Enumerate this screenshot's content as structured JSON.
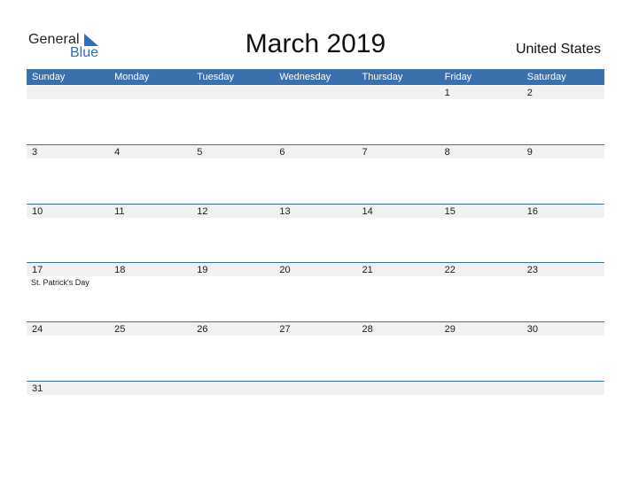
{
  "logo": {
    "general": "General",
    "blue": "Blue"
  },
  "title": "March 2019",
  "country": "United States",
  "weekdays": [
    "Sunday",
    "Monday",
    "Tuesday",
    "Wednesday",
    "Thursday",
    "Friday",
    "Saturday"
  ],
  "weeks": [
    [
      "",
      "",
      "",
      "",
      "",
      "1",
      "2"
    ],
    [
      "3",
      "4",
      "5",
      "6",
      "7",
      "8",
      "9"
    ],
    [
      "10",
      "11",
      "12",
      "13",
      "14",
      "15",
      "16"
    ],
    [
      "17",
      "18",
      "19",
      "20",
      "21",
      "22",
      "23"
    ],
    [
      "24",
      "25",
      "26",
      "27",
      "28",
      "29",
      "30"
    ],
    [
      "31",
      "",
      "",
      "",
      "",
      "",
      ""
    ]
  ],
  "holidays": {
    "st_patricks": "St. Patrick's Day"
  },
  "colors": {
    "accent": "#3a6fb0",
    "logo_blue": "#2a6fc0",
    "day_bar": "#f1f1f1"
  }
}
